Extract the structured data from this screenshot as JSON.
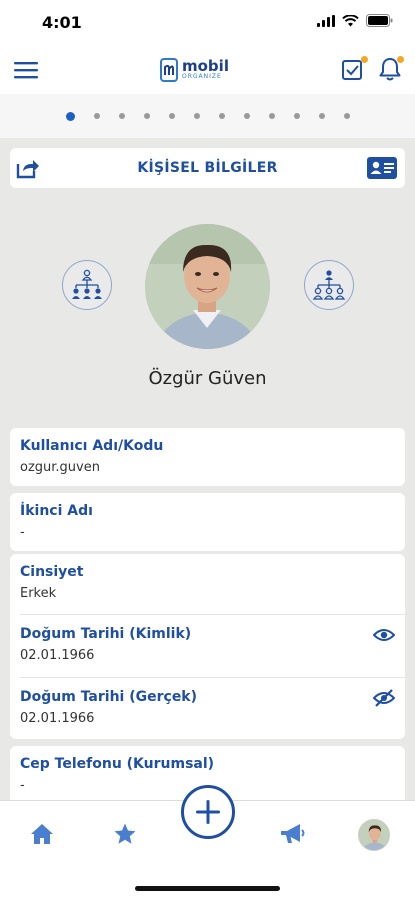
{
  "status_bar": {
    "time": "4:01"
  },
  "header": {
    "logo_main": "mobil",
    "logo_sub": "ORGANIZE",
    "icons": [
      "menu-icon",
      "task-check-icon",
      "bell-icon"
    ]
  },
  "pager": {
    "dot_count": 12,
    "active_index": 0
  },
  "section": {
    "title": "KİŞİSEL BİLGİLER"
  },
  "profile": {
    "name": "Özgür Güven"
  },
  "fields": {
    "username": {
      "label": "Kullanıcı Adı/Kodu",
      "value": "ozgur.guven"
    },
    "middle_name": {
      "label": "İkinci Adı",
      "value": "-"
    },
    "gender": {
      "label": "Cinsiyet",
      "value": "Erkek"
    },
    "birth_id": {
      "label": "Doğum Tarihi (Kimlik)",
      "value": "02.01.1966"
    },
    "birth_real": {
      "label": "Doğum Tarihi (Gerçek)",
      "value": "02.01.1966"
    },
    "phone_corp": {
      "label": "Cep Telefonu (Kurumsal)",
      "value": "-"
    }
  },
  "colors": {
    "primary": "#1f4fa3",
    "accent": "#f5a623",
    "background": "#e8e8e6"
  }
}
